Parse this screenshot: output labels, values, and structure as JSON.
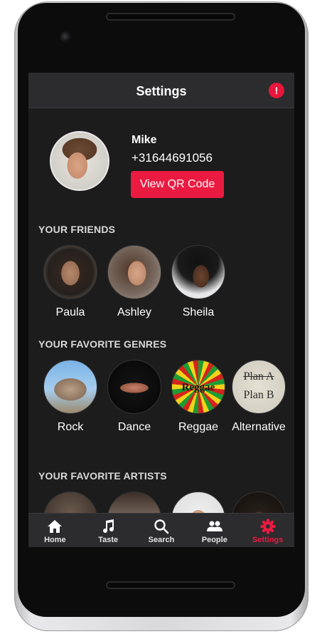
{
  "nav": {
    "title": "Settings",
    "alert_symbol": "!"
  },
  "profile": {
    "name": "Mike",
    "phone": "+31644691056",
    "qr_button_label": "View QR Code"
  },
  "sections": {
    "friends_title": "YOUR FRIENDS",
    "genres_title": "YOUR FAVORITE GENRES",
    "artists_title": "YOUR FAVORITE ARTISTS"
  },
  "friends": [
    {
      "name": "Paula"
    },
    {
      "name": "Ashley"
    },
    {
      "name": "Sheila"
    }
  ],
  "genres": [
    {
      "name": "Rock"
    },
    {
      "name": "Dance"
    },
    {
      "name": "Reggae",
      "artwork_text": "Reggae"
    },
    {
      "name": "Alternative",
      "artwork_text_top": "Plan A",
      "artwork_text_bottom": "Plan B"
    }
  ],
  "tabs": [
    {
      "label": "Home",
      "icon": "home-icon"
    },
    {
      "label": "Taste",
      "icon": "music-note-icon"
    },
    {
      "label": "Search",
      "icon": "search-icon"
    },
    {
      "label": "People",
      "icon": "people-icon"
    },
    {
      "label": "Settings",
      "icon": "gear-icon",
      "active": true
    }
  ],
  "colors": {
    "accent": "#ea1a40",
    "background": "#1c1c1d",
    "bar": "#2c2c2e"
  }
}
